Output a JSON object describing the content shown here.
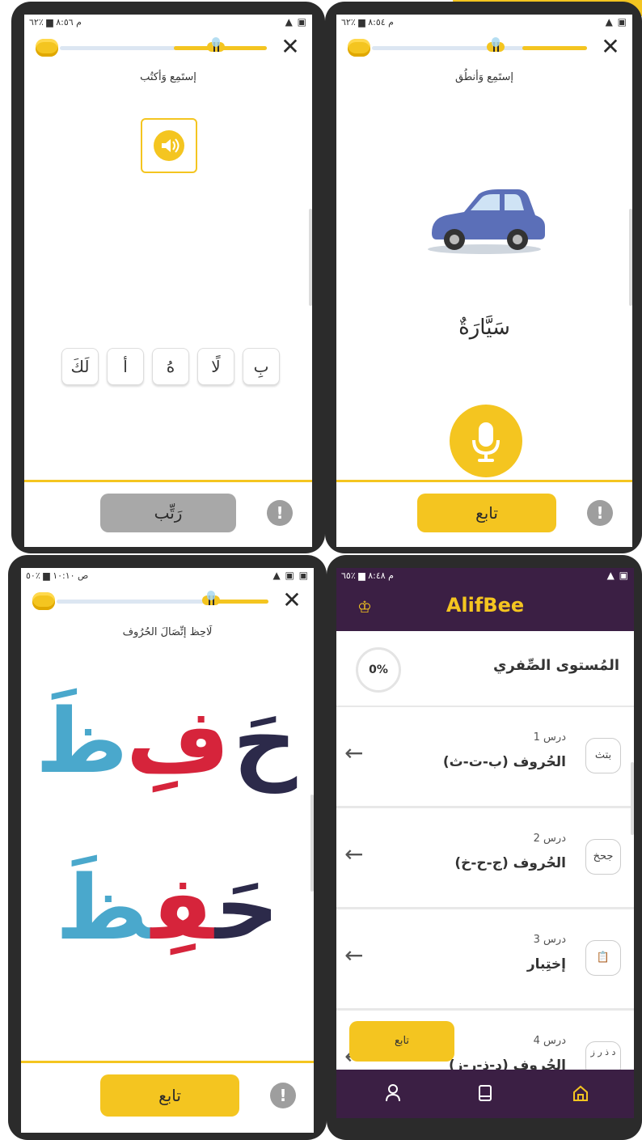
{
  "screen1": {
    "status": {
      "time": "م ٨:٥٦ ▆ ٪٦٢",
      "icons": "▲ ▣"
    },
    "title": "إستَمِع وَأكتُب",
    "tiles": [
      "لَكَ",
      "أ",
      "هُ",
      "لًا",
      "بِ"
    ],
    "order_button": "رَتِّب",
    "info": "!"
  },
  "screen2": {
    "status": {
      "time": "م ٨:٥٤ ▆ ٪٦٢",
      "icons": "▲ ▣"
    },
    "title": "إستَمِع وَأنطُق",
    "word": "سَيَّارَةٌ",
    "continue_button": "تابع",
    "info": "!"
  },
  "screen3": {
    "status": {
      "time": "ص ١٠:١٠ ▆ ٪٥٠",
      "icons": "▲ ▣ ▣"
    },
    "title": "لَاحِظ إتِّصَالَ الحُرُوف",
    "letters": [
      "حَ",
      "فِ",
      "ظَ"
    ],
    "joined": {
      "part1": "حَ",
      "part2": "فِ",
      "part3": "ظَ"
    },
    "continue_button": "تابع",
    "info": "!"
  },
  "screen4": {
    "status": {
      "time": "م ٨:٤٨ ▆ ٪٦٥",
      "icons": "▲ ▣"
    },
    "brand": "AlifBee",
    "level_title": "المُستوى الصِّفري",
    "level_progress": "0%",
    "lessons": [
      {
        "num": "درس 1",
        "name": "الحُروف (ب-ت-ث)",
        "icon": "بتث"
      },
      {
        "num": "درس 2",
        "name": "الحُروف (ج-ح-خ)",
        "icon": "جحخ"
      },
      {
        "num": "درس 3",
        "name": "إختِبار",
        "icon": "📋"
      },
      {
        "num": "درس 4",
        "name": "الحُروف (د-ذ-ر-ز)",
        "icon": "د ذ ر ز"
      }
    ],
    "float_button": "تابع"
  },
  "colors": {
    "accent": "#f4c520",
    "dark": "#2b2b2b",
    "navy": "#2c2a4a",
    "red": "#d6243b",
    "blue": "#4aa8cc",
    "purple": "#3b1f44"
  }
}
